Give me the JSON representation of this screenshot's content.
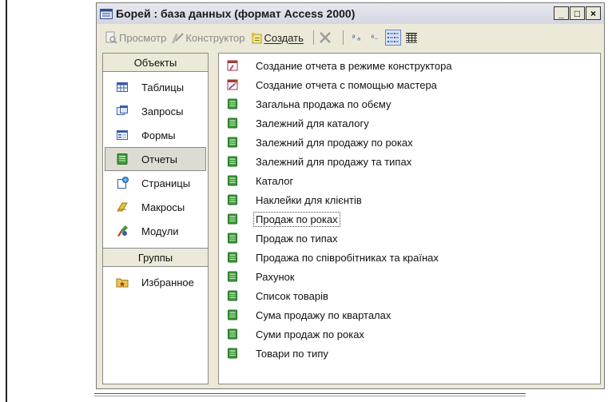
{
  "window": {
    "title": "Борей : база данных (формат Access 2000)",
    "controls": [
      "_",
      "□",
      "×"
    ]
  },
  "toolbar": {
    "preview_label": "Просмотр",
    "design_label": "Конструктор",
    "create_label": "Создать",
    "small_icons_glyph": "ᵃ ₐ",
    "list_glyph": "ᵃ₋"
  },
  "left_panel": {
    "objects_header": "Объекты",
    "items": [
      {
        "label": "Таблицы",
        "icon": "table-icon"
      },
      {
        "label": "Запросы",
        "icon": "query-icon"
      },
      {
        "label": "Формы",
        "icon": "form-icon"
      },
      {
        "label": "Отчеты",
        "icon": "report-icon",
        "selected": true
      },
      {
        "label": "Страницы",
        "icon": "page-icon"
      },
      {
        "label": "Макросы",
        "icon": "macro-icon"
      },
      {
        "label": "Модули",
        "icon": "module-icon"
      }
    ],
    "groups_header": "Группы",
    "groups": [
      {
        "label": "Избранное",
        "icon": "favorites-folder-icon"
      }
    ]
  },
  "report_list": [
    {
      "label": "Создание отчета в режиме конструктора",
      "icon": "design-wizard-icon"
    },
    {
      "label": "Создание отчета с помощью мастера",
      "icon": "wizard-icon"
    },
    {
      "label": "Загальна продажа по обєму",
      "icon": "report-icon"
    },
    {
      "label": "Залежний для каталогу",
      "icon": "report-icon"
    },
    {
      "label": "Залежний для продажу по роках",
      "icon": "report-icon"
    },
    {
      "label": "Залежний для продажу та типах",
      "icon": "report-icon"
    },
    {
      "label": "Каталог",
      "icon": "report-icon"
    },
    {
      "label": "Наклейки для клієнтів",
      "icon": "report-icon"
    },
    {
      "label": "Продаж по роках",
      "icon": "report-icon",
      "focused": true
    },
    {
      "label": "Продаж по типах",
      "icon": "report-icon"
    },
    {
      "label": "Продажа по співробітниках та країнах",
      "icon": "report-icon"
    },
    {
      "label": "Рахунок",
      "icon": "report-icon"
    },
    {
      "label": "Список товарів",
      "icon": "report-icon"
    },
    {
      "label": "Сума продажу по кварталах",
      "icon": "report-icon"
    },
    {
      "label": "Суми продаж по роках",
      "icon": "report-icon"
    },
    {
      "label": "Товари по типу",
      "icon": "report-icon"
    }
  ],
  "colors": {
    "report_green": "#3f9a3a",
    "selection_bg": "#dedcd2",
    "window_bg": "#ece9d8"
  }
}
